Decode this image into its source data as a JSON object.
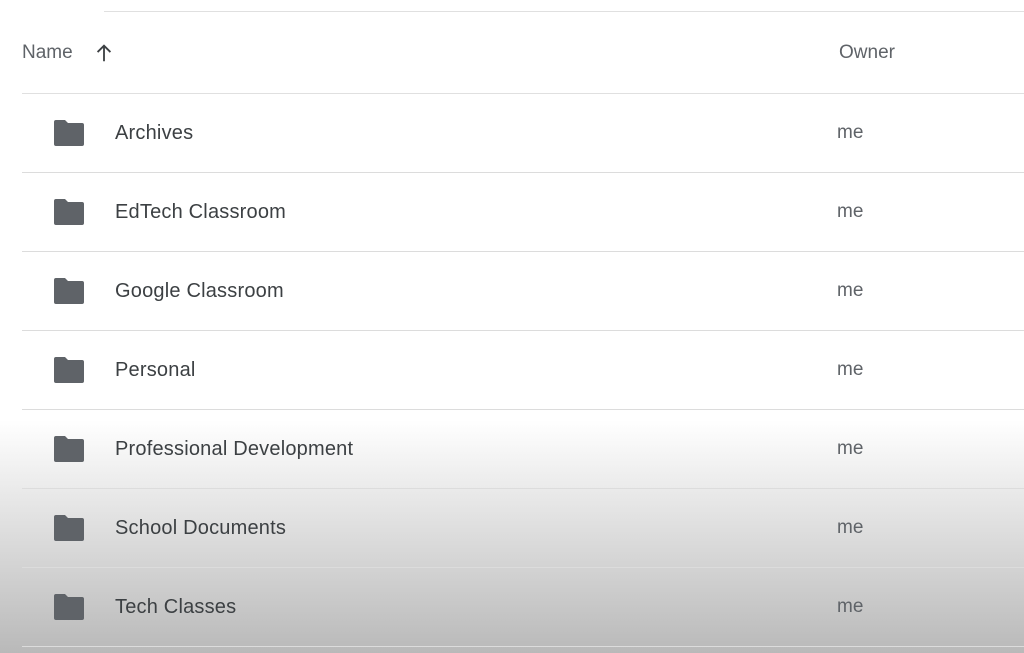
{
  "header": {
    "name_label": "Name",
    "owner_label": "Owner",
    "sort_icon": "arrow-up-icon"
  },
  "folders": [
    {
      "name": "Archives",
      "owner": "me",
      "icon": "folder-icon"
    },
    {
      "name": "EdTech Classroom",
      "owner": "me",
      "icon": "folder-icon"
    },
    {
      "name": "Google Classroom",
      "owner": "me",
      "icon": "folder-icon"
    },
    {
      "name": "Personal",
      "owner": "me",
      "icon": "folder-icon"
    },
    {
      "name": "Professional Development",
      "owner": "me",
      "icon": "folder-icon"
    },
    {
      "name": "School Documents",
      "owner": "me",
      "icon": "folder-icon"
    },
    {
      "name": "Tech Classes",
      "owner": "me",
      "icon": "folder-icon"
    }
  ],
  "colors": {
    "folder": "#5f6368",
    "text_primary": "#3c4043",
    "text_secondary": "#5f6368",
    "divider": "#e0e0e0"
  }
}
